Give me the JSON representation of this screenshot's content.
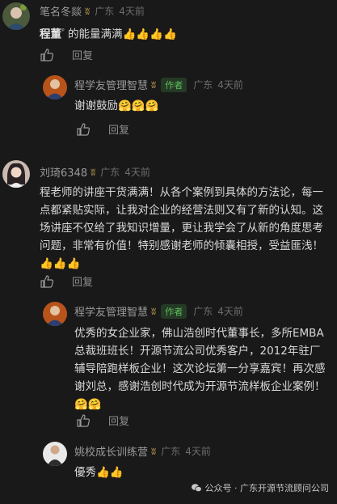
{
  "comments": [
    {
      "user": "笔名冬燚",
      "location": "广东",
      "time": "4天前",
      "text_highlight": "程董",
      "search_glyph": "ᵠ",
      "text": "的能量满满",
      "emoji": "👍👍👍👍",
      "reply_label": "回复"
    },
    {
      "user": "程学友管理智慧",
      "author_badge": "作者",
      "location": "广东",
      "time": "4天前",
      "text": "谢谢鼓励",
      "emoji": "🤗🤗🤗",
      "reply_label": "回复"
    },
    {
      "user": "刘琦6348",
      "location": "广东",
      "time": "4天前",
      "lines": [
        "程老师的讲座干货满满！从各个案例到具体的方法论，每一",
        "点都紧贴实际，让我对企业的经营法则又有了新的认知。这",
        "场讲座不仅给了我知识增量，更让我学会了从新的角度思考",
        "问题，非常有价值！特别感谢老师的倾囊相授，受益匪浅！"
      ],
      "emoji": "👍👍👍",
      "reply_label": "回复"
    },
    {
      "user": "程学友管理智慧",
      "author_badge": "作者",
      "location": "广东",
      "time": "4天前",
      "lines": [
        "优秀的女企业家，佛山浩创时代董事长，多所EMBA",
        "总裁班班长！开源节流公司优秀客户，2012年驻厂",
        "辅导陪跑样板企业！这次论坛第一分享嘉宾！再次感",
        "谢刘总，感谢浩创时代成为开源节流样板企业案例！"
      ],
      "emoji": "🤗🤗",
      "reply_label": "回复"
    },
    {
      "user": "姚校成长训练营",
      "location": "广东",
      "time": "4天前",
      "text": "優秀",
      "emoji": "👍👍",
      "reply_label": "回复"
    }
  ],
  "watermark": {
    "text": "公众号 · 广东开源节流顾问公司"
  },
  "icons": {
    "like": "thumbs-up-icon",
    "bolt": "lightning-icon",
    "wechat": "wechat-icon"
  }
}
